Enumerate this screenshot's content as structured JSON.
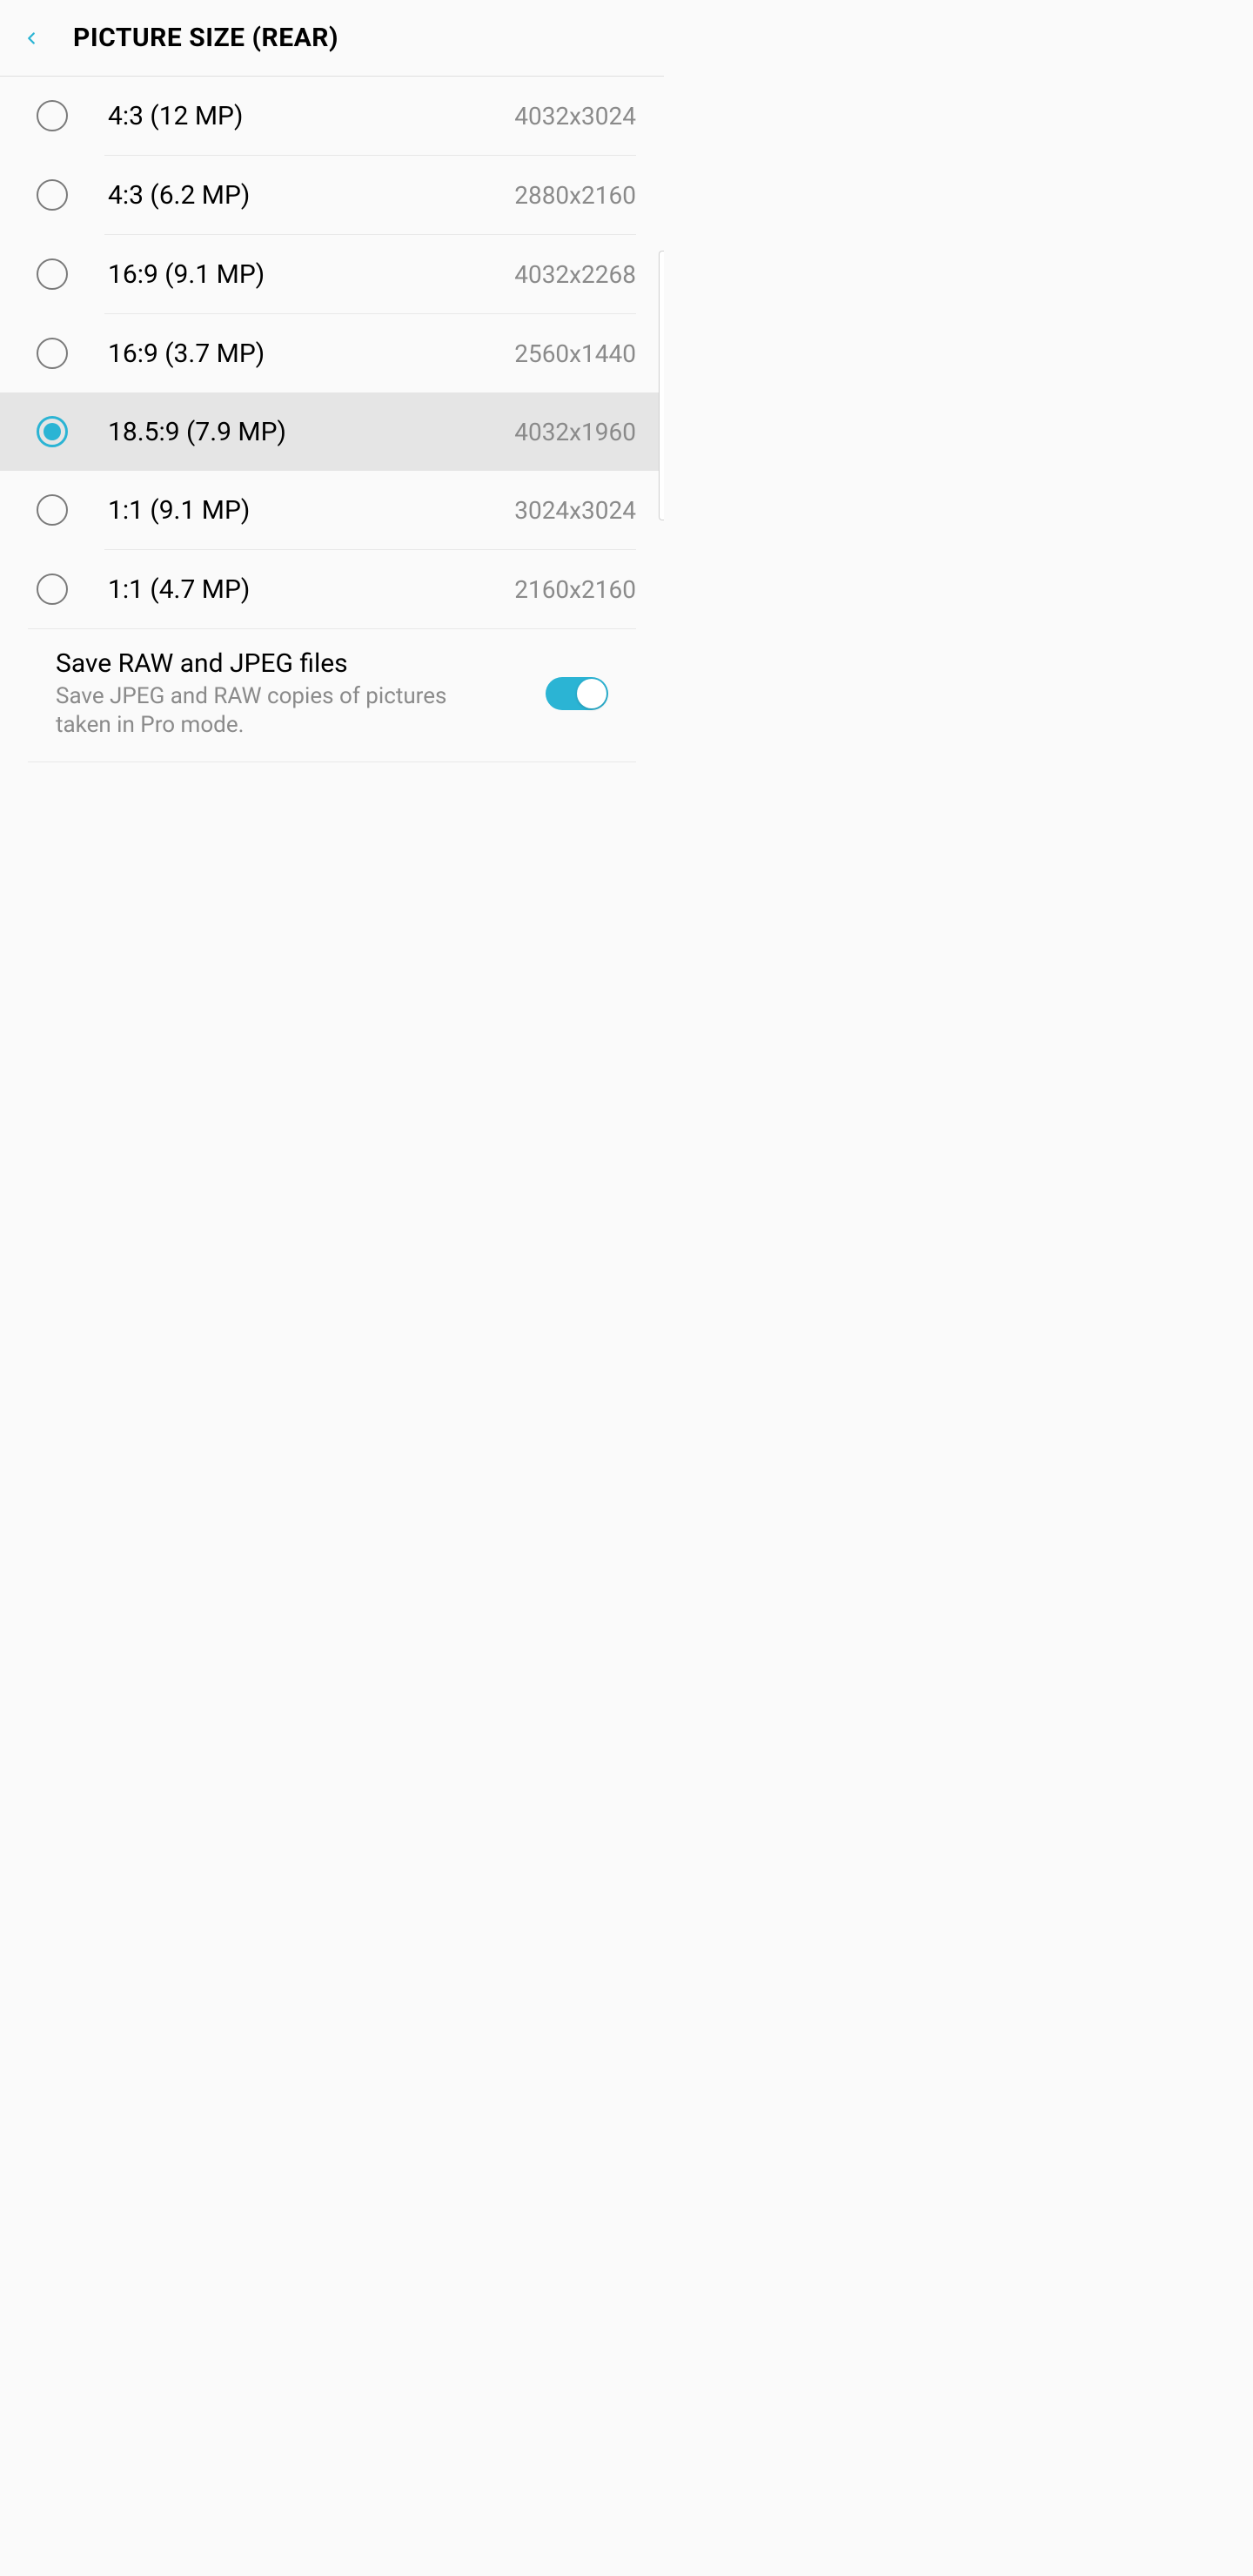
{
  "header": {
    "title": "PICTURE SIZE (REAR)"
  },
  "options": [
    {
      "label": "4:3 (12 MP)",
      "resolution": "4032x3024",
      "selected": false
    },
    {
      "label": "4:3 (6.2 MP)",
      "resolution": "2880x2160",
      "selected": false
    },
    {
      "label": "16:9 (9.1 MP)",
      "resolution": "4032x2268",
      "selected": false
    },
    {
      "label": "16:9 (3.7 MP)",
      "resolution": "2560x1440",
      "selected": false
    },
    {
      "label": "18.5:9 (7.9 MP)",
      "resolution": "4032x1960",
      "selected": true
    },
    {
      "label": "1:1 (9.1 MP)",
      "resolution": "3024x3024",
      "selected": false
    },
    {
      "label": "1:1 (4.7 MP)",
      "resolution": "2160x2160",
      "selected": false
    }
  ],
  "raw": {
    "title": "Save RAW and JPEG files",
    "description": "Save JPEG and RAW copies of pictures taken in Pro mode.",
    "enabled": true
  }
}
